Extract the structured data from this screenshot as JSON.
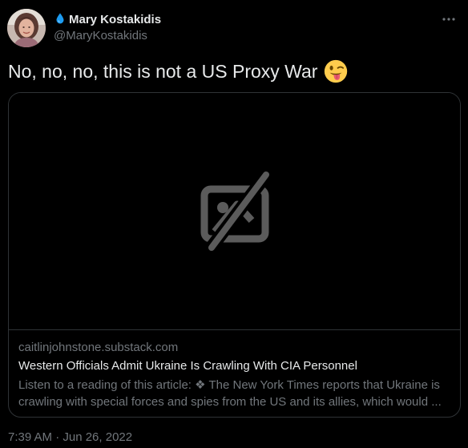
{
  "tweet": {
    "author": {
      "display_name": "Mary Kostakidis",
      "handle": "@MaryKostakidis",
      "name_icon": "water-drop-icon",
      "avatar": "avatar-photo"
    },
    "text": "No, no, no, this is not a US Proxy War",
    "emoji": "winking-face-with-tongue",
    "card": {
      "media_icon": "image-unavailable-icon",
      "domain": "caitlinjohnstone.substack.com",
      "title": "Western Officials Admit Ukraine Is Crawling With CIA Personnel",
      "description": "Listen to a reading of this article: ❖ The New York Times reports that Ukraine is crawling with special forces and spies from the US and its allies, which would ..."
    },
    "timestamp": "7:39 AM · Jun 26, 2022",
    "more_icon": "more-options-icon"
  },
  "colors": {
    "background": "#000000",
    "text_primary": "#e7e9ea",
    "text_secondary": "#71767b",
    "border": "#2f3336",
    "drop_icon": "#1d9bf0"
  }
}
